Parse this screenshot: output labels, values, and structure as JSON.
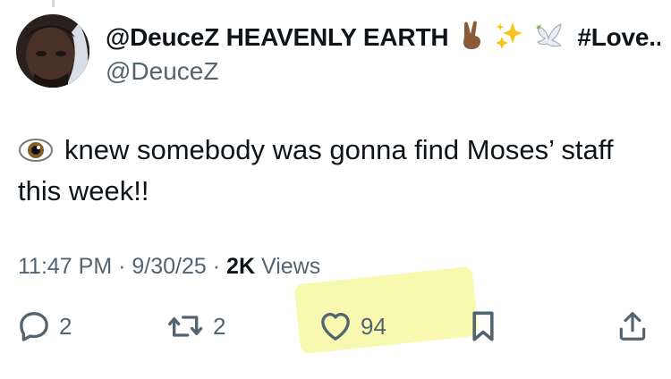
{
  "user": {
    "display_name": "@DeuceZ HEAVENLY EARTH",
    "tag": "#Love...",
    "handle": "@DeuceZ",
    "name_emojis": [
      "victory-hand-icon",
      "sparkles-icon",
      "dove-icon"
    ]
  },
  "tweet": {
    "emoji": "eye-icon",
    "text": "knew somebody was gonna find Moses’ staff this week!!"
  },
  "meta": {
    "time": "11:47 PM",
    "sep1": "·",
    "date": "9/30/25",
    "sep2": "·",
    "views_count": "2K",
    "views_label": "Views"
  },
  "actions": {
    "replies": "2",
    "retweets": "2",
    "likes": "94"
  },
  "colors": {
    "text": "#0f1419",
    "muted": "#536471",
    "highlight": "#f7f7a2"
  }
}
